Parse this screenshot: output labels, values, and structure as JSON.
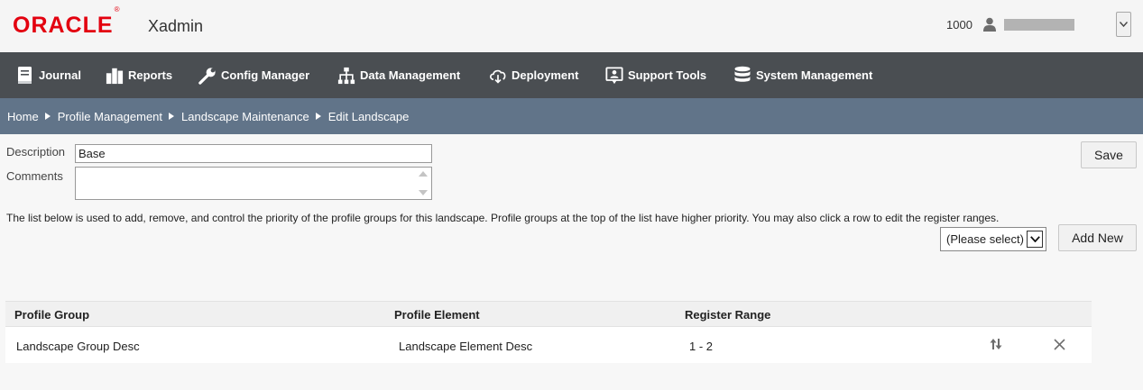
{
  "header": {
    "brand": "ORACLE",
    "brand_mark": "®",
    "app_name": "Xadmin",
    "store_number": "1000"
  },
  "nav": [
    {
      "label": "Journal",
      "icon": "journal-icon"
    },
    {
      "label": "Reports",
      "icon": "reports-icon"
    },
    {
      "label": "Config Manager",
      "icon": "wrench-icon"
    },
    {
      "label": "Data Management",
      "icon": "hierarchy-icon"
    },
    {
      "label": "Deployment",
      "icon": "cloud-download-icon"
    },
    {
      "label": "Support Tools",
      "icon": "support-icon"
    },
    {
      "label": "System Management",
      "icon": "database-icon"
    }
  ],
  "breadcrumb": [
    "Home",
    "Profile Management",
    "Landscape Maintenance",
    "Edit Landscape"
  ],
  "form": {
    "description_label": "Description",
    "description_value": "Base",
    "comments_label": "Comments",
    "comments_value": "",
    "save_label": "Save",
    "instructions": "The list below is used to add, remove, and control the priority of the profile groups for this landscape. Profile groups at the top of the list have higher priority. You may also click a row to edit the register ranges.",
    "select_value": "(Please select)",
    "add_new_label": "Add New"
  },
  "table": {
    "columns": [
      "Profile Group",
      "Profile Element",
      "Register Range"
    ],
    "rows": [
      {
        "group": "Landscape Group Desc",
        "element": "Landscape Element Desc",
        "range": "1 - 2"
      }
    ]
  },
  "colors": {
    "brand_red": "#e3000f",
    "nav_bg": "#4a4e52",
    "breadcrumb_bg": "#617489"
  }
}
